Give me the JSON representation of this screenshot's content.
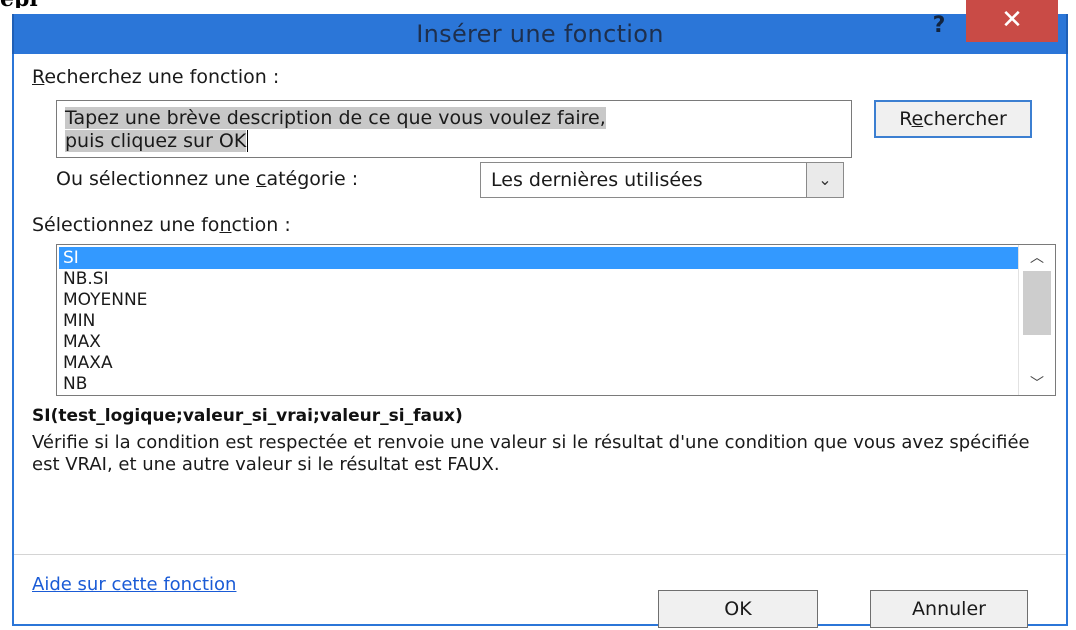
{
  "page_fragment": "epl",
  "dialog": {
    "title": "Insérer une fonction",
    "help_glyph": "?",
    "close_glyph": "✕"
  },
  "search": {
    "label_prefix": "",
    "label_underlined": "R",
    "label_rest": "echerchez une fonction :",
    "value_line1": "Tapez une brève description de ce que vous voulez faire,",
    "value_line2": "puis cliquez sur OK",
    "button_prefix": "R",
    "button_underlined": "e",
    "button_rest": "chercher"
  },
  "category": {
    "label_prefix": "Ou sélectionnez une ",
    "label_underlined": "c",
    "label_rest": "atégorie :",
    "selected": "Les dernières utilisées",
    "arrow_glyph": "⌄"
  },
  "function_list": {
    "label_prefix": "Sélectionnez une fo",
    "label_underlined": "n",
    "label_rest": "ction :",
    "items": [
      "SI",
      "NB.SI",
      "MOYENNE",
      "MIN",
      "MAX",
      "MAXA",
      "NB"
    ],
    "selected_index": 0,
    "scroll_up_glyph": "︿",
    "scroll_down_glyph": "﹀"
  },
  "details": {
    "signature": "SI(test_logique;valeur_si_vrai;valeur_si_faux)",
    "description": "Vérifie si la condition est respectée et renvoie une valeur si le résultat d'une condition que vous avez spécifiée est VRAI, et une autre valeur si le résultat est FAUX."
  },
  "footer": {
    "help_link": "Aide sur cette fonction",
    "ok_label": "OK",
    "cancel_label": "Annuler"
  },
  "colors": {
    "title_bar": "#2b76d8",
    "close_button": "#c94b46",
    "selection": "#3399ff",
    "link": "#1a5bd6"
  }
}
